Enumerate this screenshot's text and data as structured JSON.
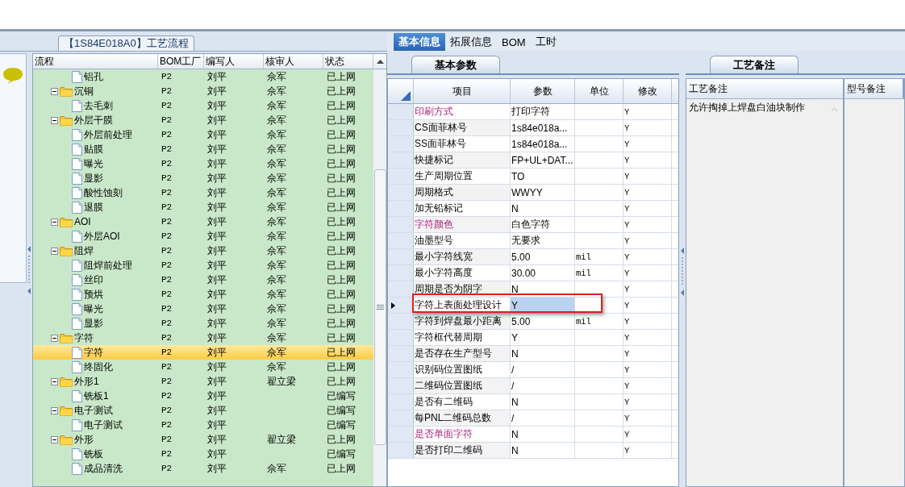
{
  "process_panel": {
    "title": "【1S84E018A0】工艺流程",
    "columns": [
      "流程",
      "BOM工厂",
      "编写人",
      "核审人",
      "状态"
    ],
    "rows": [
      {
        "kind": "file",
        "label": "铝孔",
        "factory": "P2",
        "author": "刘平",
        "reviewer": "佘军",
        "status": "已上网",
        "selected": false
      },
      {
        "kind": "folder",
        "label": "沉铜",
        "factory": "P2",
        "author": "刘平",
        "reviewer": "佘军",
        "status": "已上网",
        "selected": false,
        "expanded": true,
        "children": [
          {
            "kind": "file",
            "label": "去毛刺",
            "factory": "P2",
            "author": "刘平",
            "reviewer": "佘军",
            "status": "已上网",
            "selected": false
          }
        ]
      },
      {
        "kind": "folder",
        "label": "外层干膜",
        "factory": "P2",
        "author": "刘平",
        "reviewer": "佘军",
        "status": "已上网",
        "selected": false,
        "expanded": true,
        "children": [
          {
            "kind": "file",
            "label": "外层前处理",
            "factory": "P2",
            "author": "刘平",
            "reviewer": "佘军",
            "status": "已上网",
            "selected": false
          },
          {
            "kind": "file",
            "label": "贴膜",
            "factory": "P2",
            "author": "刘平",
            "reviewer": "佘军",
            "status": "已上网",
            "selected": false
          },
          {
            "kind": "file",
            "label": "曝光",
            "factory": "P2",
            "author": "刘平",
            "reviewer": "佘军",
            "status": "已上网",
            "selected": false
          },
          {
            "kind": "file",
            "label": "显影",
            "factory": "P2",
            "author": "刘平",
            "reviewer": "佘军",
            "status": "已上网",
            "selected": false
          },
          {
            "kind": "file",
            "label": "酸性蚀刻",
            "factory": "P2",
            "author": "刘平",
            "reviewer": "佘军",
            "status": "已上网",
            "selected": false
          },
          {
            "kind": "file",
            "label": "退膜",
            "factory": "P2",
            "author": "刘平",
            "reviewer": "佘军",
            "status": "已上网",
            "selected": false
          }
        ]
      },
      {
        "kind": "folder",
        "label": "AOI",
        "factory": "P2",
        "author": "刘平",
        "reviewer": "佘军",
        "status": "已上网",
        "selected": false,
        "expanded": true,
        "children": [
          {
            "kind": "file",
            "label": "外层AOI",
            "factory": "P2",
            "author": "刘平",
            "reviewer": "佘军",
            "status": "已上网",
            "selected": false
          }
        ]
      },
      {
        "kind": "folder",
        "label": "阻焊",
        "factory": "P2",
        "author": "刘平",
        "reviewer": "佘军",
        "status": "已上网",
        "selected": false,
        "expanded": true,
        "children": [
          {
            "kind": "file",
            "label": "阻焊前处理",
            "factory": "P2",
            "author": "刘平",
            "reviewer": "佘军",
            "status": "已上网",
            "selected": false
          },
          {
            "kind": "file",
            "label": "丝印",
            "factory": "P2",
            "author": "刘平",
            "reviewer": "佘军",
            "status": "已上网",
            "selected": false
          },
          {
            "kind": "file",
            "label": "预烘",
            "factory": "P2",
            "author": "刘平",
            "reviewer": "佘军",
            "status": "已上网",
            "selected": false
          },
          {
            "kind": "file",
            "label": "曝光",
            "factory": "P2",
            "author": "刘平",
            "reviewer": "佘军",
            "status": "已上网",
            "selected": false
          },
          {
            "kind": "file",
            "label": "显影",
            "factory": "P2",
            "author": "刘平",
            "reviewer": "佘军",
            "status": "已上网",
            "selected": false
          }
        ]
      },
      {
        "kind": "folder",
        "label": "字符",
        "factory": "P2",
        "author": "刘平",
        "reviewer": "佘军",
        "status": "已上网",
        "selected": false,
        "expanded": true,
        "children": [
          {
            "kind": "file",
            "label": "字符",
            "factory": "P2",
            "author": "刘平",
            "reviewer": "佘军",
            "status": "已上网",
            "selected": true
          },
          {
            "kind": "file",
            "label": "终固化",
            "factory": "P2",
            "author": "刘平",
            "reviewer": "佘军",
            "status": "已上网",
            "selected": false
          }
        ]
      },
      {
        "kind": "folder",
        "label": "外形1",
        "factory": "P2",
        "author": "刘平",
        "reviewer": "翟立梁",
        "status": "已上网",
        "selected": false,
        "expanded": true,
        "children": [
          {
            "kind": "file",
            "label": "铣板1",
            "factory": "P2",
            "author": "刘平",
            "status": "已编写",
            "selected": false
          }
        ]
      },
      {
        "kind": "folder",
        "label": "电子测试",
        "factory": "P2",
        "author": "刘平",
        "status": "已编写",
        "selected": false,
        "expanded": true,
        "children": [
          {
            "kind": "file",
            "label": "电子测试",
            "factory": "P2",
            "author": "刘平",
            "status": "已编写",
            "selected": false
          }
        ]
      },
      {
        "kind": "folder",
        "label": "外形",
        "factory": "P2",
        "author": "刘平",
        "reviewer": "翟立梁",
        "status": "已上网",
        "selected": false,
        "expanded": true,
        "children": [
          {
            "kind": "file",
            "label": "铣板",
            "factory": "P2",
            "author": "刘平",
            "status": "已编写",
            "selected": false
          },
          {
            "kind": "file",
            "label": "成品清洗",
            "factory": "P2",
            "author": "刘平",
            "reviewer": "佘军",
            "status": "已上网",
            "selected": false
          }
        ]
      }
    ]
  },
  "info_tabs": [
    {
      "label": "基本信息",
      "selected": true
    },
    {
      "label": "拓展信息",
      "selected": false
    },
    {
      "label": "BOM",
      "selected": false
    },
    {
      "label": "工时",
      "selected": false
    }
  ],
  "params": {
    "tab": "基本参数",
    "columns": [
      "项目",
      "参数",
      "单位",
      "修改"
    ],
    "rows": [
      {
        "item": "印刷方式",
        "value": "打印字符",
        "modify": "Y",
        "emphasis": true,
        "current": false
      },
      {
        "item": "CS面菲林号",
        "value": "1s84e018a...",
        "modify": "Y",
        "emphasis": false,
        "current": false
      },
      {
        "item": "SS面菲林号",
        "value": "1s84e018a...",
        "modify": "Y",
        "emphasis": false,
        "current": false
      },
      {
        "item": "快捷标记",
        "value": "FP+UL+DAT...",
        "modify": "Y",
        "emphasis": false,
        "current": false
      },
      {
        "item": "生产周期位置",
        "value": "TO",
        "modify": "Y",
        "emphasis": false,
        "current": false
      },
      {
        "item": "周期格式",
        "value": "WWYY",
        "modify": "Y",
        "emphasis": false,
        "current": false
      },
      {
        "item": "加无铅标记",
        "value": "N",
        "modify": "Y",
        "emphasis": false,
        "current": false
      },
      {
        "item": "字符颜色",
        "value": "白色字符",
        "modify": "Y",
        "emphasis": true,
        "current": false
      },
      {
        "item": "油墨型号",
        "value": "无要求",
        "modify": "Y",
        "emphasis": false,
        "current": false
      },
      {
        "item": "最小字符线宽",
        "value": "5.00",
        "unit": "mil",
        "modify": "Y",
        "emphasis": false,
        "current": false
      },
      {
        "item": "最小字符高度",
        "value": "30.00",
        "unit": "mil",
        "modify": "Y",
        "emphasis": false,
        "current": false
      },
      {
        "item": "周期是否为阴字",
        "value": "N",
        "modify": "Y",
        "emphasis": false,
        "current": false
      },
      {
        "item": "字符上表面处理设计",
        "value": "Y",
        "modify": "Y",
        "emphasis": false,
        "current": true,
        "annotated": true
      },
      {
        "item": "字符到焊盘最小距离",
        "value": "5.00",
        "unit": "mil",
        "modify": "Y",
        "emphasis": false,
        "current": false
      },
      {
        "item": "字符框代替周期",
        "value": "Y",
        "modify": "Y",
        "emphasis": false,
        "current": false
      },
      {
        "item": "是否存在生产型号",
        "value": "N",
        "modify": "Y",
        "emphasis": false,
        "current": false
      },
      {
        "item": "识别码位置图纸",
        "value": "/",
        "modify": "Y",
        "emphasis": false,
        "current": false
      },
      {
        "item": "二维码位置图纸",
        "value": "/",
        "modify": "Y",
        "emphasis": false,
        "current": false
      },
      {
        "item": "是否有二维码",
        "value": "N",
        "modify": "Y",
        "emphasis": false,
        "current": false
      },
      {
        "item": "每PNL二维码总数",
        "value": "/",
        "modify": "Y",
        "emphasis": false,
        "current": false
      },
      {
        "item": "是否单面字符",
        "value": "N",
        "modify": "Y",
        "emphasis": true,
        "current": false
      },
      {
        "item": "是否打印二维码",
        "value": "N",
        "modify": "Y",
        "emphasis": false,
        "current": false
      }
    ]
  },
  "notes": {
    "tab": "工艺备注",
    "columns": [
      "工艺备注",
      "型号备注"
    ],
    "process_note": "允许掏掉上焊盘白油块制作"
  }
}
